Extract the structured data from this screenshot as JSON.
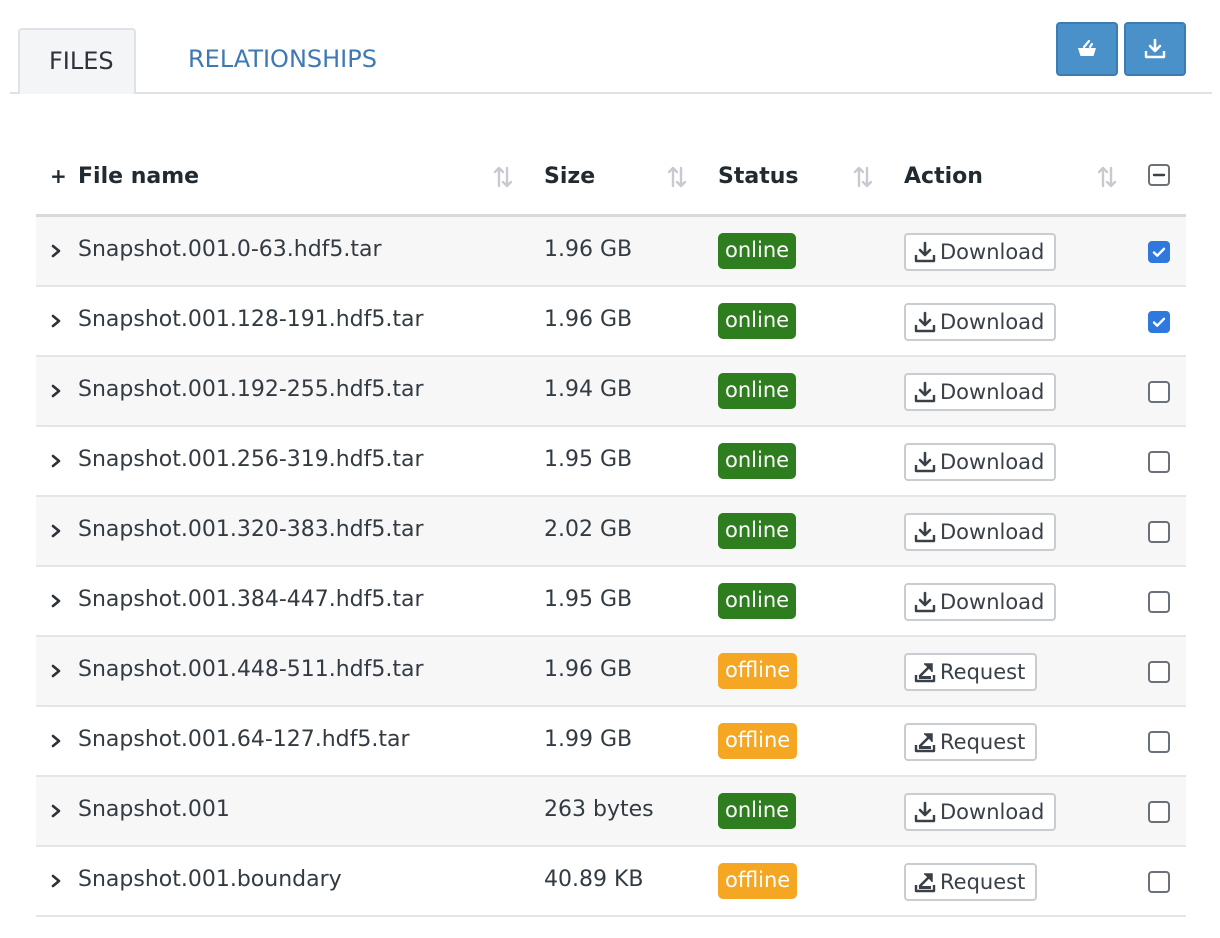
{
  "tabs": [
    {
      "label": "FILES",
      "active": true
    },
    {
      "label": "RELATIONSHIPS",
      "active": false
    }
  ],
  "toolbar": {
    "icons": [
      "basket-icon",
      "download-all-icon"
    ],
    "accent_color": "#4a90c9"
  },
  "table": {
    "columns": [
      "File name",
      "Size",
      "Status",
      "Action"
    ],
    "expand_all_glyph": "+",
    "header_checkbox_state": "indeterminate",
    "status_colors": {
      "online": "#2e7d1e",
      "offline": "#f5a623"
    },
    "rows": [
      {
        "name": "Snapshot.001.0-63.hdf5.tar",
        "size": "1.96 GB",
        "status": "online",
        "action": "Download",
        "checked": true
      },
      {
        "name": "Snapshot.001.128-191.hdf5.tar",
        "size": "1.96 GB",
        "status": "online",
        "action": "Download",
        "checked": true
      },
      {
        "name": "Snapshot.001.192-255.hdf5.tar",
        "size": "1.94 GB",
        "status": "online",
        "action": "Download",
        "checked": false
      },
      {
        "name": "Snapshot.001.256-319.hdf5.tar",
        "size": "1.95 GB",
        "status": "online",
        "action": "Download",
        "checked": false
      },
      {
        "name": "Snapshot.001.320-383.hdf5.tar",
        "size": "2.02 GB",
        "status": "online",
        "action": "Download",
        "checked": false
      },
      {
        "name": "Snapshot.001.384-447.hdf5.tar",
        "size": "1.95 GB",
        "status": "online",
        "action": "Download",
        "checked": false
      },
      {
        "name": "Snapshot.001.448-511.hdf5.tar",
        "size": "1.96 GB",
        "status": "offline",
        "action": "Request",
        "checked": false
      },
      {
        "name": "Snapshot.001.64-127.hdf5.tar",
        "size": "1.99 GB",
        "status": "offline",
        "action": "Request",
        "checked": false
      },
      {
        "name": "Snapshot.001",
        "size": "263 bytes",
        "status": "online",
        "action": "Download",
        "checked": false
      },
      {
        "name": "Snapshot.001.boundary",
        "size": "40.89 KB",
        "status": "offline",
        "action": "Request",
        "checked": false
      }
    ]
  }
}
